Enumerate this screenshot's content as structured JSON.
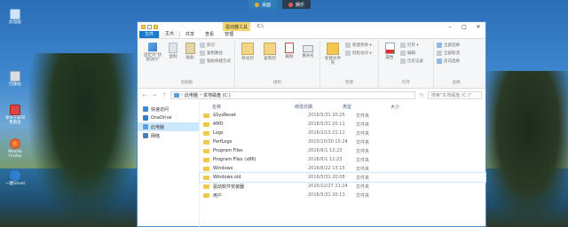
{
  "desktop_tabs": [
    {
      "label": "桌面",
      "active": true
    },
    {
      "label": "娱乐",
      "active": false
    }
  ],
  "desktop_icons": [
    {
      "label": "此电脑",
      "icon": "computer-icon"
    },
    {
      "label": "回收站",
      "icon": "recycle-bin-icon"
    },
    {
      "label": "净水宁安间 鲁图会",
      "icon": "app-icon"
    },
    {
      "label": "Mozilla Firefox",
      "icon": "firefox-icon"
    },
    {
      "label": "一键Ghost",
      "icon": "ghost-icon"
    }
  ],
  "window": {
    "title_path": "C:\\",
    "context_tab": "驱动器工具",
    "ribbon_tabs": [
      "文件",
      "主页",
      "共享",
      "查看",
      "管理"
    ],
    "active_tab": "主页"
  },
  "ribbon": {
    "clipboard": {
      "label": "剪贴板",
      "pin": "固定到\"快速访问\"",
      "copy": "复制",
      "paste": "粘贴",
      "cut": "剪切",
      "copy_path": "复制路径",
      "paste_shortcut": "粘贴快捷方式"
    },
    "organize": {
      "label": "组织",
      "move_to": "移动到",
      "copy_to": "复制到",
      "delete": "删除",
      "rename": "重命名"
    },
    "new": {
      "label": "新建",
      "new_folder": "新建文件夹",
      "new_item": "新建项目 ▾",
      "easy_access": "轻松访问 ▾"
    },
    "open": {
      "label": "打开",
      "properties": "属性",
      "open": "打开 ▾",
      "edit": "编辑",
      "history": "历史记录"
    },
    "select": {
      "label": "选择",
      "select_all": "全部选择",
      "select_none": "全部取消",
      "invert": "反向选择"
    }
  },
  "address": {
    "crumbs": [
      "此电脑",
      "本地磁盘 (C:)"
    ],
    "search_placeholder": "搜索\"本地磁盘 (C:)\""
  },
  "nav_pane": [
    {
      "label": "快速访问",
      "icon": "star-icon",
      "color": "#3b8ad8",
      "selected": false
    },
    {
      "label": "OneDrive",
      "icon": "cloud-icon",
      "color": "#2f7fd0",
      "selected": false
    },
    {
      "label": "此电脑",
      "icon": "computer-icon",
      "color": "#5aa0e0",
      "selected": true
    },
    {
      "label": "网络",
      "icon": "network-icon",
      "color": "#4d7fb0",
      "selected": false
    }
  ],
  "columns": {
    "name": "名称",
    "date": "修改日期",
    "type": "类型",
    "size": "大小"
  },
  "files": [
    {
      "name": "$SysReset",
      "date": "2016/5/31 20:25",
      "type": "文件夹"
    },
    {
      "name": "AMD",
      "date": "2016/5/31 20:11",
      "type": "文件夹"
    },
    {
      "name": "Logs",
      "date": "2016/2/13 21:11",
      "type": "文件夹"
    },
    {
      "name": "PerfLogs",
      "date": "2015/10/30 15:24",
      "type": "文件夹"
    },
    {
      "name": "Program Files",
      "date": "2016/6/1 12:23",
      "type": "文件夹"
    },
    {
      "name": "Program Files (x86)",
      "date": "2016/6/1 12:23",
      "type": "文件夹"
    },
    {
      "name": "Windows",
      "date": "2016/6/22 13:15",
      "type": "文件夹"
    },
    {
      "name": "Windows.old",
      "date": "2016/5/31 20:08",
      "type": "文件夹"
    },
    {
      "name": "驱动软件安装器",
      "date": "2015/12/27 21:24",
      "type": "文件夹"
    },
    {
      "name": "用户",
      "date": "2016/5/31 20:13",
      "type": "文件夹"
    }
  ],
  "selected_file_index": 7
}
